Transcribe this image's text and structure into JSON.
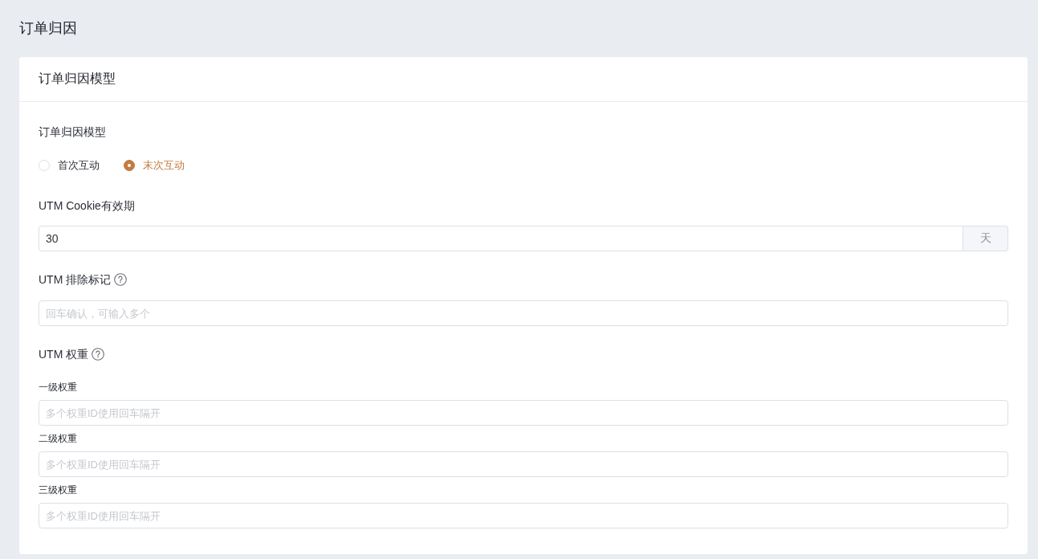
{
  "page_title": "订单归因",
  "card": {
    "title": "订单归因模型",
    "fields": [
      {
        "kind": "radio",
        "label": "订单归因模型",
        "options": [
          {
            "label": "首次互动",
            "selected": false
          },
          {
            "label": "末次互动",
            "selected": true
          }
        ]
      },
      {
        "kind": "unit_input",
        "label": "UTM Cookie有效期",
        "value": "30",
        "unit": "天"
      },
      {
        "kind": "input",
        "label": "UTM 排除标记",
        "help": true,
        "placeholder": "回车确认，可输入多个"
      },
      {
        "kind": "levels",
        "label": "UTM 权重",
        "help": true,
        "levels": [
          {
            "label": "一级权重",
            "placeholder": "多个权重ID使用回车隔开"
          },
          {
            "label": "二级权重",
            "placeholder": "多个权重ID使用回车隔开"
          },
          {
            "label": "三级权重",
            "placeholder": "多个权重ID使用回车隔开"
          }
        ]
      }
    ]
  }
}
